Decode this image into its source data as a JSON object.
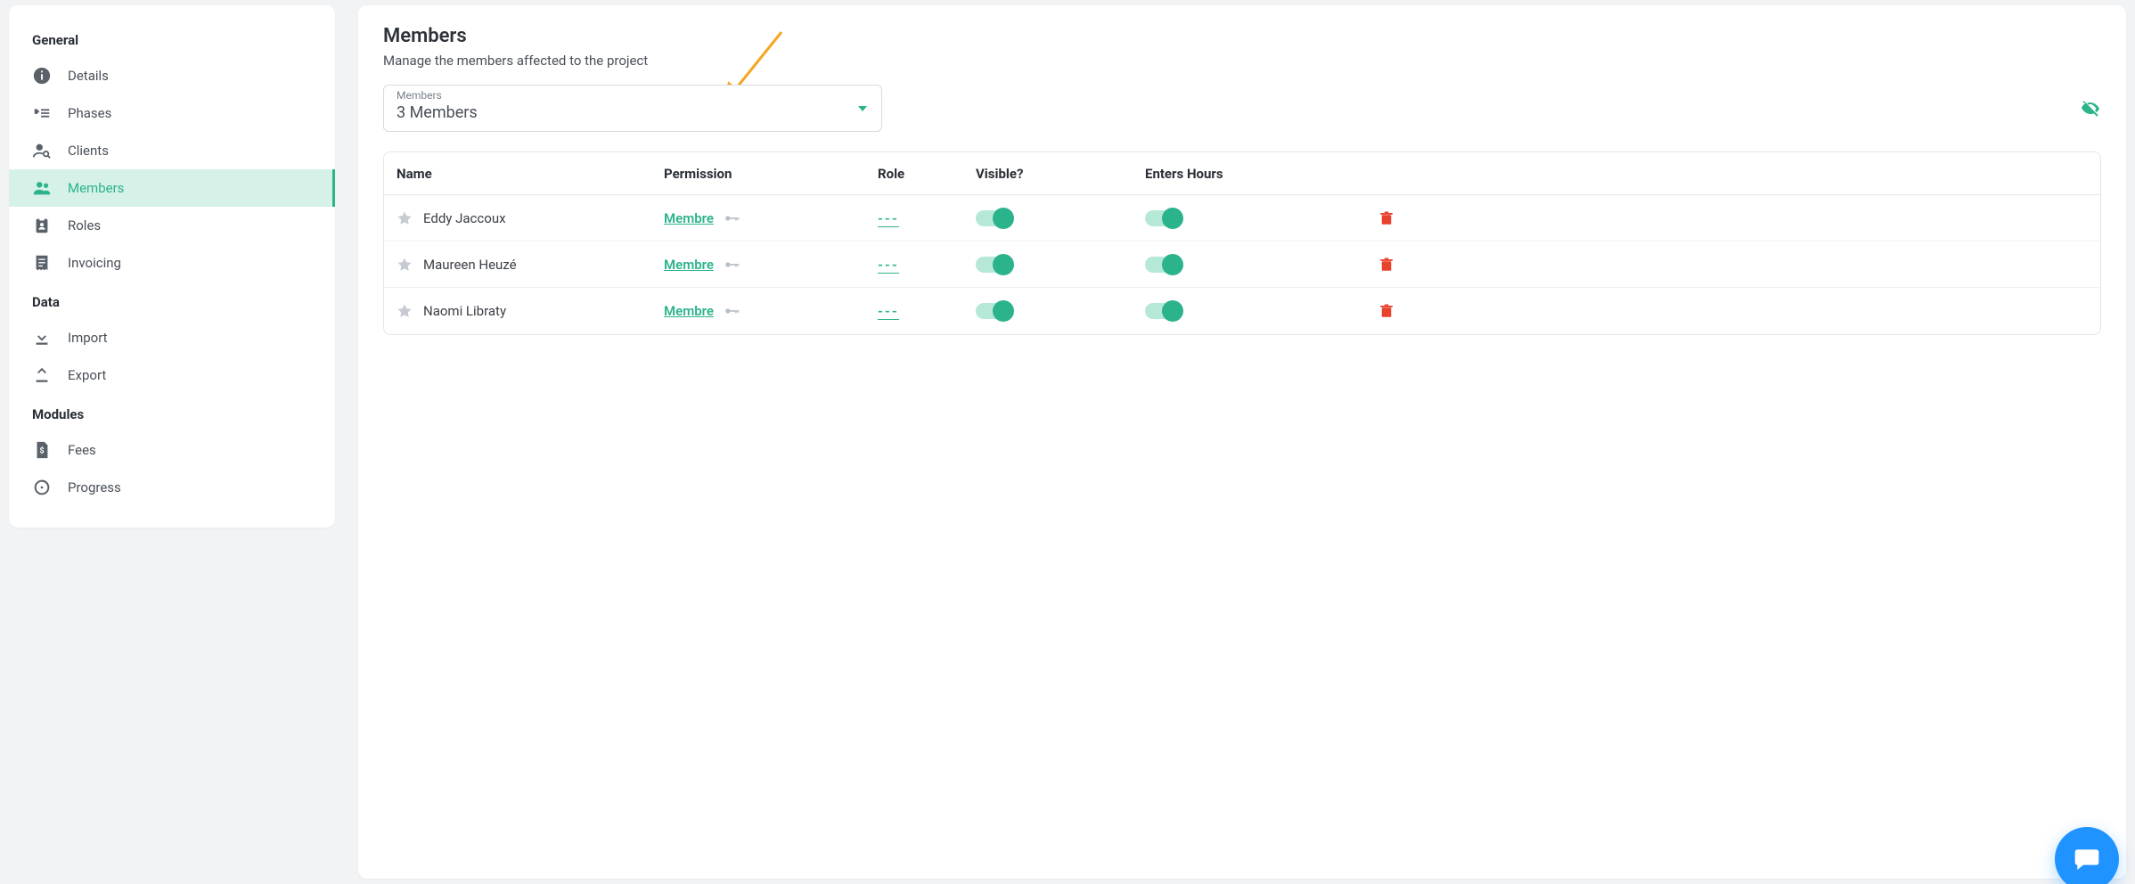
{
  "sidebar": {
    "sections": [
      {
        "label": "General",
        "items": [
          {
            "id": "details",
            "label": "Details",
            "active": false
          },
          {
            "id": "phases",
            "label": "Phases",
            "active": false
          },
          {
            "id": "clients",
            "label": "Clients",
            "active": false
          },
          {
            "id": "members",
            "label": "Members",
            "active": true
          },
          {
            "id": "roles",
            "label": "Roles",
            "active": false
          },
          {
            "id": "invoicing",
            "label": "Invoicing",
            "active": false
          }
        ]
      },
      {
        "label": "Data",
        "items": [
          {
            "id": "import",
            "label": "Import",
            "active": false
          },
          {
            "id": "export",
            "label": "Export",
            "active": false
          }
        ]
      },
      {
        "label": "Modules",
        "items": [
          {
            "id": "fees",
            "label": "Fees",
            "active": false
          },
          {
            "id": "progress",
            "label": "Progress",
            "active": false
          }
        ]
      }
    ]
  },
  "page": {
    "title": "Members",
    "subtitle": "Manage the members affected to the project"
  },
  "select": {
    "label": "Members",
    "value": "3 Members"
  },
  "table": {
    "headers": {
      "name": "Name",
      "permission": "Permission",
      "role": "Role",
      "visible": "Visible?",
      "enters_hours": "Enters Hours"
    },
    "rows": [
      {
        "name": "Eddy Jaccoux",
        "permission": "Membre",
        "role": "---",
        "visible": true,
        "enters_hours": true
      },
      {
        "name": "Maureen Heuzé",
        "permission": "Membre",
        "role": "---",
        "visible": true,
        "enters_hours": true
      },
      {
        "name": "Naomi Libraty",
        "permission": "Membre",
        "role": "---",
        "visible": true,
        "enters_hours": true
      }
    ]
  }
}
